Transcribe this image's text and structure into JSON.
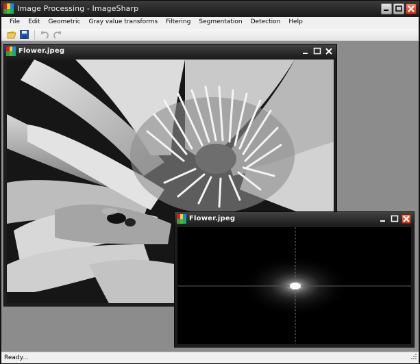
{
  "app": {
    "title": "Image Processing - ImageSharp"
  },
  "menu": [
    "File",
    "Edit",
    "Geometric",
    "Gray value transforms",
    "Filtering",
    "Segmentation",
    "Detection",
    "Help"
  ],
  "toolbar": {
    "open_icon": "folder-open-icon",
    "save_icon": "floppy-disk-icon",
    "undo_icon": "undo-icon",
    "redo_icon": "redo-icon"
  },
  "child_windows": [
    {
      "title": "Flower.jpeg",
      "content": "grayscale-flower-photo"
    },
    {
      "title": "Flower.jpeg",
      "content": "fourier-spectrum"
    }
  ],
  "status": {
    "text": "Ready..."
  },
  "colors": {
    "mdi_background": "#8c8c8c",
    "titlebar_dark": "#1c1c1c",
    "close_red": "#c6311a"
  }
}
